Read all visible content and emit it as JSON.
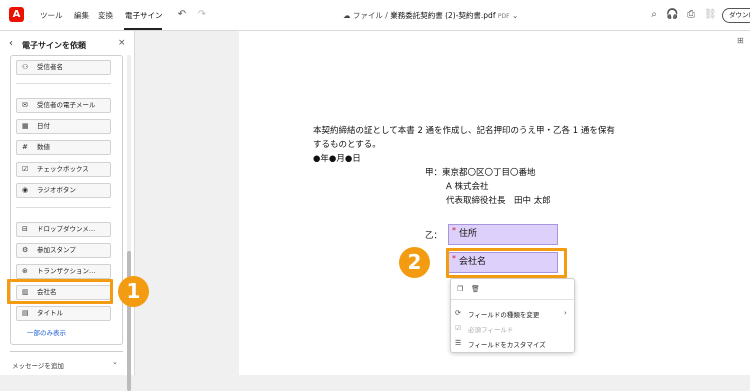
{
  "topbar": {
    "menu": [
      "ツール",
      "編集",
      "変換",
      "電子サイン"
    ],
    "breadcrumb_folder": "ファイル",
    "breadcrumb_sep": "/",
    "filename": "業務委託契約書 (2)-契約書.pdf",
    "ext": "PDF",
    "download_label": "ダウンロ"
  },
  "panel": {
    "title": "電子サインを依頼",
    "fields": [
      "受信者名",
      "受信者の電子メール",
      "日付",
      "数値",
      "チェックボックス",
      "ラジオボタン",
      "ドロップダウンメ…",
      "参加スタンプ",
      "トランザクション…",
      "会社名",
      "タイトル"
    ],
    "more_link": "一部のみ表示",
    "message_label": "メッセージを追加"
  },
  "doc": {
    "line1": "本契約締結の証として本書 2 通を作成し、記名押印のうえ甲・乙各 1 通を保有",
    "line2": "するものとする。",
    "line3": "●年●月●日",
    "party1_label": "甲：東京都〇区〇丁目〇番地",
    "party1_company": "A 株式会社",
    "party1_rep": "代表取締役社長　田中 太郎",
    "party2_label": "乙：",
    "field_address": "住所",
    "field_company": "会社名",
    "required_mark": "*"
  },
  "context_menu": {
    "change_type": "フィールドの種類を変更",
    "required": "必須フィールド",
    "customize": "フィールドをカスタマイズ"
  },
  "badges": [
    "1",
    "2"
  ],
  "colors": {
    "accent_orange": "#f39c12",
    "field_fill": "#ddd0fa",
    "link_blue": "#1e5fd6",
    "acrobat_red": "#eb1000"
  }
}
